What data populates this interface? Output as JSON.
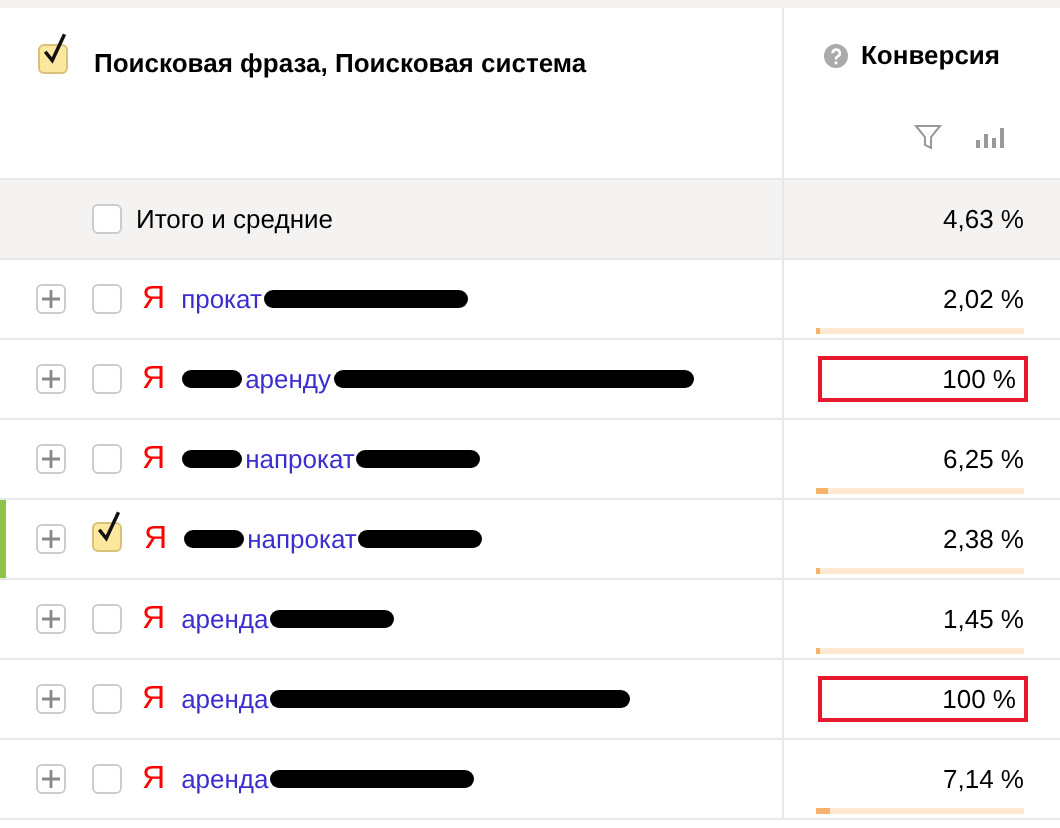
{
  "header": {
    "checked": true,
    "dimension": "Поисковая фраза, Поисковая система",
    "metric": "Конверсия"
  },
  "totals": {
    "label": "Итого и средние",
    "checked": false,
    "value": "4,63 %"
  },
  "rows": [
    {
      "checked": false,
      "engine": "Я",
      "segments": [
        {
          "kind": "text",
          "text": "прокат"
        },
        {
          "kind": "long"
        }
      ],
      "value": "2,02 %",
      "level": 0.02,
      "highlighted": false
    },
    {
      "checked": false,
      "engine": "Я",
      "segments": [
        {
          "kind": "short"
        },
        {
          "kind": "text",
          "text": "аренду"
        },
        {
          "kind": "longest"
        }
      ],
      "value": "100 %",
      "highlighted": true
    },
    {
      "checked": false,
      "engine": "Я",
      "segments": [
        {
          "kind": "short"
        },
        {
          "kind": "text",
          "text": "напрокат"
        },
        {
          "kind": "medium"
        }
      ],
      "value": "6,25 %",
      "level": 0.06,
      "highlighted": false
    },
    {
      "checked": true,
      "engine": "Я",
      "segments": [
        {
          "kind": "short"
        },
        {
          "kind": "text",
          "text": "напрокат"
        },
        {
          "kind": "medium"
        }
      ],
      "value": "2,38 %",
      "level": 0.02,
      "highlighted": false
    },
    {
      "checked": false,
      "engine": "Я",
      "segments": [
        {
          "kind": "text",
          "text": "аренда"
        },
        {
          "kind": "medium"
        }
      ],
      "value": "1,45 %",
      "level": 0.01,
      "highlighted": false
    },
    {
      "checked": false,
      "engine": "Я",
      "segments": [
        {
          "kind": "text",
          "text": "аренда"
        },
        {
          "kind": "longest"
        }
      ],
      "value": "100 %",
      "highlighted": true
    },
    {
      "checked": false,
      "engine": "Я",
      "segments": [
        {
          "kind": "text",
          "text": "аренда"
        },
        {
          "kind": "long"
        }
      ],
      "value": "7,14 %",
      "level": 0.07,
      "highlighted": false
    }
  ]
}
